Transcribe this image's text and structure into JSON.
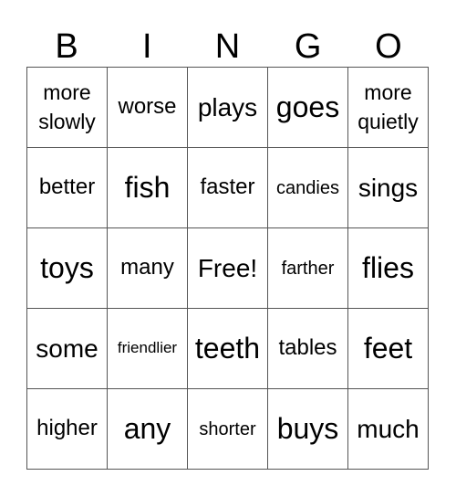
{
  "header": {
    "letters": [
      "B",
      "I",
      "N",
      "G",
      "O"
    ]
  },
  "card": {
    "cells": [
      [
        "more\nslowly",
        "worse",
        "plays",
        "goes",
        "more\nquietly"
      ],
      [
        "better",
        "fish",
        "faster",
        "candies",
        "sings"
      ],
      [
        "toys",
        "many",
        "Free!",
        "farther",
        "flies"
      ],
      [
        "some",
        "friendlier",
        "teeth",
        "tables",
        "feet"
      ],
      [
        "higher",
        "any",
        "shorter",
        "buys",
        "much"
      ]
    ],
    "free_space": "Free!"
  }
}
